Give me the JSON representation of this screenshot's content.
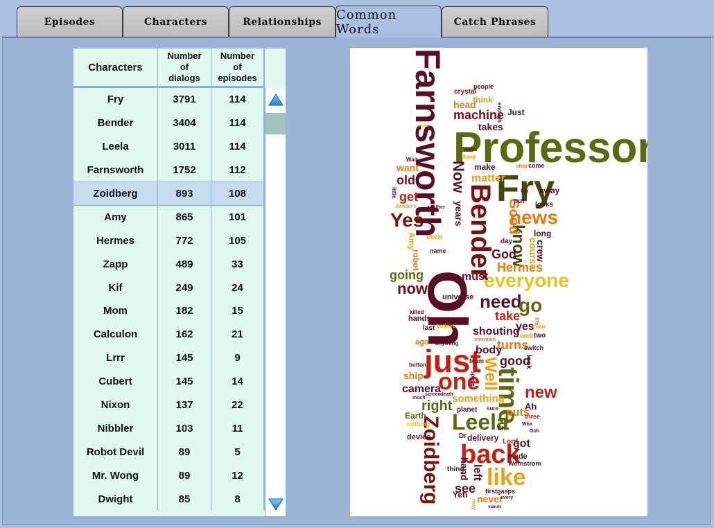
{
  "tabs": [
    {
      "label": "Episodes",
      "active": false
    },
    {
      "label": "Characters",
      "active": false
    },
    {
      "label": "Relationships",
      "active": false
    },
    {
      "label": "Common Words",
      "active": true
    },
    {
      "label": "Catch Phrases",
      "active": false
    }
  ],
  "table": {
    "headers": {
      "characters": "Characters",
      "dialogs_line1": "Number",
      "dialogs_line2": "of",
      "dialogs_line3": "dialogs",
      "episodes_line1": "Number",
      "episodes_line2": "of",
      "episodes_line3": "episodes"
    },
    "selected_row": "Zoidberg",
    "rows": [
      {
        "name": "Fry",
        "dialogs": "3791",
        "episodes": "114"
      },
      {
        "name": "Bender",
        "dialogs": "3404",
        "episodes": "114"
      },
      {
        "name": "Leela",
        "dialogs": "3011",
        "episodes": "114"
      },
      {
        "name": "Farnsworth",
        "dialogs": "1752",
        "episodes": "112"
      },
      {
        "name": "Zoidberg",
        "dialogs": "893",
        "episodes": "108"
      },
      {
        "name": "Amy",
        "dialogs": "865",
        "episodes": "101"
      },
      {
        "name": "Hermes",
        "dialogs": "772",
        "episodes": "105"
      },
      {
        "name": "Zapp",
        "dialogs": "489",
        "episodes": "33"
      },
      {
        "name": "Kif",
        "dialogs": "249",
        "episodes": "24"
      },
      {
        "name": "Mom",
        "dialogs": "182",
        "episodes": "15"
      },
      {
        "name": "Calculon",
        "dialogs": "162",
        "episodes": "21"
      },
      {
        "name": "Lrrr",
        "dialogs": "145",
        "episodes": "9"
      },
      {
        "name": "Cubert",
        "dialogs": "145",
        "episodes": "14"
      },
      {
        "name": "Nixon",
        "dialogs": "137",
        "episodes": "22"
      },
      {
        "name": "Nibbler",
        "dialogs": "103",
        "episodes": "11"
      },
      {
        "name": "Robot Devil",
        "dialogs": "89",
        "episodes": "5"
      },
      {
        "name": "Mr. Wong",
        "dialogs": "89",
        "episodes": "12"
      },
      {
        "name": "Dwight",
        "dialogs": "85",
        "episodes": "8"
      }
    ]
  },
  "scrollbar": {
    "up_icon": "arrow-up-icon",
    "down_icon": "arrow-down-icon",
    "position": 0.02
  },
  "word_cloud": {
    "words": [
      {
        "text": "Farnsworth",
        "color": "#5a0e26"
      },
      {
        "text": "Professor",
        "color": "#5b6a0e"
      },
      {
        "text": "Bender",
        "color": "#7a1010"
      },
      {
        "text": "Fry",
        "color": "#3f4a0c"
      },
      {
        "text": "Oh",
        "color": "#5a0e26"
      },
      {
        "text": "just",
        "color": "#c81e10"
      },
      {
        "text": "time",
        "color": "#5b6a0e"
      },
      {
        "text": "back",
        "color": "#c81e10"
      },
      {
        "text": "Zoidberg",
        "color": "#7a1010"
      },
      {
        "text": "Leela",
        "color": "#5b6a0e"
      },
      {
        "text": "like",
        "color": "#e8a214"
      },
      {
        "text": "everyone",
        "color": "#e8c414"
      },
      {
        "text": "news",
        "color": "#e87a10"
      },
      {
        "text": "Now",
        "color": "#5a0e26"
      },
      {
        "text": "one",
        "color": "#c81e10"
      },
      {
        "text": "Well",
        "color": "#e8a214"
      },
      {
        "text": "Yes",
        "color": "#7a1010"
      },
      {
        "text": "need",
        "color": "#5a0e26"
      },
      {
        "text": "go",
        "color": "#5b6a0e"
      },
      {
        "text": "know",
        "color": "#3f4a0c"
      },
      {
        "text": "Good",
        "color": "#e87a10"
      },
      {
        "text": "now",
        "color": "#7a1010"
      },
      {
        "text": "machine",
        "color": "#7a1010"
      },
      {
        "text": "new",
        "color": "#c81e10"
      },
      {
        "text": "take",
        "color": "#c81e10"
      },
      {
        "text": "good",
        "color": "#5a0e26"
      },
      {
        "text": "right",
        "color": "#5b6a0e"
      },
      {
        "text": "turns",
        "color": "#e87a10"
      },
      {
        "text": "God",
        "color": "#5a0e26"
      },
      {
        "text": "Hermes",
        "color": "#e87a10"
      },
      {
        "text": "get",
        "color": "#c81e10"
      },
      {
        "text": "old",
        "color": "#7a1010"
      },
      {
        "text": "going",
        "color": "#5b6a0e"
      },
      {
        "text": "see",
        "color": "#5a0e26"
      },
      {
        "text": "camera",
        "color": "#5a0e26"
      },
      {
        "text": "something",
        "color": "#e8a214"
      },
      {
        "text": "shouting",
        "color": "#5a0e26"
      },
      {
        "text": "yes",
        "color": "#5a0e26"
      },
      {
        "text": "puts",
        "color": "#e87a10"
      },
      {
        "text": "body",
        "color": "#5a0e26"
      },
      {
        "text": "got",
        "color": "#5a0e26"
      },
      {
        "text": "must",
        "color": "#5a0e26"
      },
      {
        "text": "matter",
        "color": "#e8a214"
      },
      {
        "text": "years",
        "color": "#5a0e26"
      },
      {
        "text": "hand",
        "color": "#5a0e26"
      },
      {
        "text": "left",
        "color": "#5a0e26"
      },
      {
        "text": "never",
        "color": "#e87a10"
      },
      {
        "text": "Yeti",
        "color": "#5a0e26"
      },
      {
        "text": "ship",
        "color": "#e87a10"
      },
      {
        "text": "Earth",
        "color": "#5b6a0e"
      },
      {
        "text": "delivery",
        "color": "#5a0e26"
      },
      {
        "text": "crew",
        "color": "#5a0e26"
      },
      {
        "text": "course",
        "color": "#e8a214"
      },
      {
        "text": "away",
        "color": "#5a0e26"
      },
      {
        "text": "long",
        "color": "#5a0e26"
      },
      {
        "text": "head",
        "color": "#e87a10"
      },
      {
        "text": "think",
        "color": "#e8a214"
      },
      {
        "text": "takes",
        "color": "#5a0e26"
      },
      {
        "text": "want",
        "color": "#e87a10"
      },
      {
        "text": "make",
        "color": "#5a0e26"
      },
      {
        "text": "universe",
        "color": "#5a0e26"
      },
      {
        "text": "hands",
        "color": "#5a0e26"
      },
      {
        "text": "Just",
        "color": "#5a0e26"
      },
      {
        "text": "crystal",
        "color": "#7a1010"
      },
      {
        "text": "people",
        "color": "#5a0e26"
      },
      {
        "text": "device",
        "color": "#5a0e26"
      },
      {
        "text": "made",
        "color": "#5a0e26"
      },
      {
        "text": "Ah",
        "color": "#5a0e26"
      },
      {
        "text": "planet",
        "color": "#5a0e26"
      },
      {
        "text": "robot",
        "color": "#e87a10"
      },
      {
        "text": "Amy",
        "color": "#e8a214"
      },
      {
        "text": "name",
        "color": "#5a0e26"
      },
      {
        "text": "ago",
        "color": "#e87a10"
      },
      {
        "text": "last",
        "color": "#5a0e26"
      },
      {
        "text": "two",
        "color": "#5a0e26"
      },
      {
        "text": "well",
        "color": "#e8a214"
      },
      {
        "text": "look",
        "color": "#5a0e26"
      },
      {
        "text": "Lord",
        "color": "#c81e10"
      },
      {
        "text": "Wernstrom",
        "color": "#5a0e26"
      },
      {
        "text": "thing",
        "color": "#5a0e26"
      },
      {
        "text": "first",
        "color": "#5a0e26"
      },
      {
        "text": "gasps",
        "color": "#5a0e26"
      },
      {
        "text": "three",
        "color": "#c81e10"
      },
      {
        "text": "looks",
        "color": "#5a0e26"
      },
      {
        "text": "day",
        "color": "#5a0e26"
      },
      {
        "text": "put",
        "color": "#5a0e26"
      },
      {
        "text": "come",
        "color": "#5a0e26"
      },
      {
        "text": "Mom",
        "color": "#5a0e26"
      },
      {
        "text": "space",
        "color": "#5a0e26"
      },
      {
        "text": "Dr",
        "color": "#5a0e26"
      },
      {
        "text": "even",
        "color": "#e8a214"
      },
      {
        "text": "little",
        "color": "#5a0e26"
      },
      {
        "text": "nothing",
        "color": "#e8c414"
      },
      {
        "text": "button",
        "color": "#5a0e26"
      },
      {
        "text": "much",
        "color": "#5a0e26"
      },
      {
        "text": "enough",
        "color": "#5a0e26"
      },
      {
        "text": "anything",
        "color": "#5a0e26"
      },
      {
        "text": "believe",
        "color": "#e8a214"
      },
      {
        "text": "killed",
        "color": "#5a0e26"
      },
      {
        "text": "invention",
        "color": "#e87a10"
      },
      {
        "text": "switch",
        "color": "#5a0e26"
      },
      {
        "text": "sure",
        "color": "#5a0e26"
      },
      {
        "text": "Ooh",
        "color": "#5a0e26"
      },
      {
        "text": "every",
        "color": "#5a0e26"
      },
      {
        "text": "screen",
        "color": "#5a0e26"
      },
      {
        "text": "death",
        "color": "#5a0e26"
      },
      {
        "text": "Bender's",
        "color": "#e8a214"
      },
      {
        "text": "another",
        "color": "#5a0e26"
      },
      {
        "text": "Wait",
        "color": "#5a0e26"
      },
      {
        "text": "water",
        "color": "#e8c414"
      },
      {
        "text": "walks",
        "color": "#5a0e26"
      },
      {
        "text": "keep",
        "color": "#e8a214"
      },
      {
        "text": "stop",
        "color": "#e87a10"
      },
      {
        "text": "may",
        "color": "#e8a214"
      },
      {
        "text": "stands",
        "color": "#5a0e26"
      },
      {
        "text": "Wha",
        "color": "#5a0e26"
      },
      {
        "text": "life",
        "color": "#e87a10"
      },
      {
        "text": "Come",
        "color": "#e8a214"
      },
      {
        "text": "Go",
        "color": "#5a0e26"
      },
      {
        "text": "Uh",
        "color": "#5a0e26"
      }
    ]
  }
}
